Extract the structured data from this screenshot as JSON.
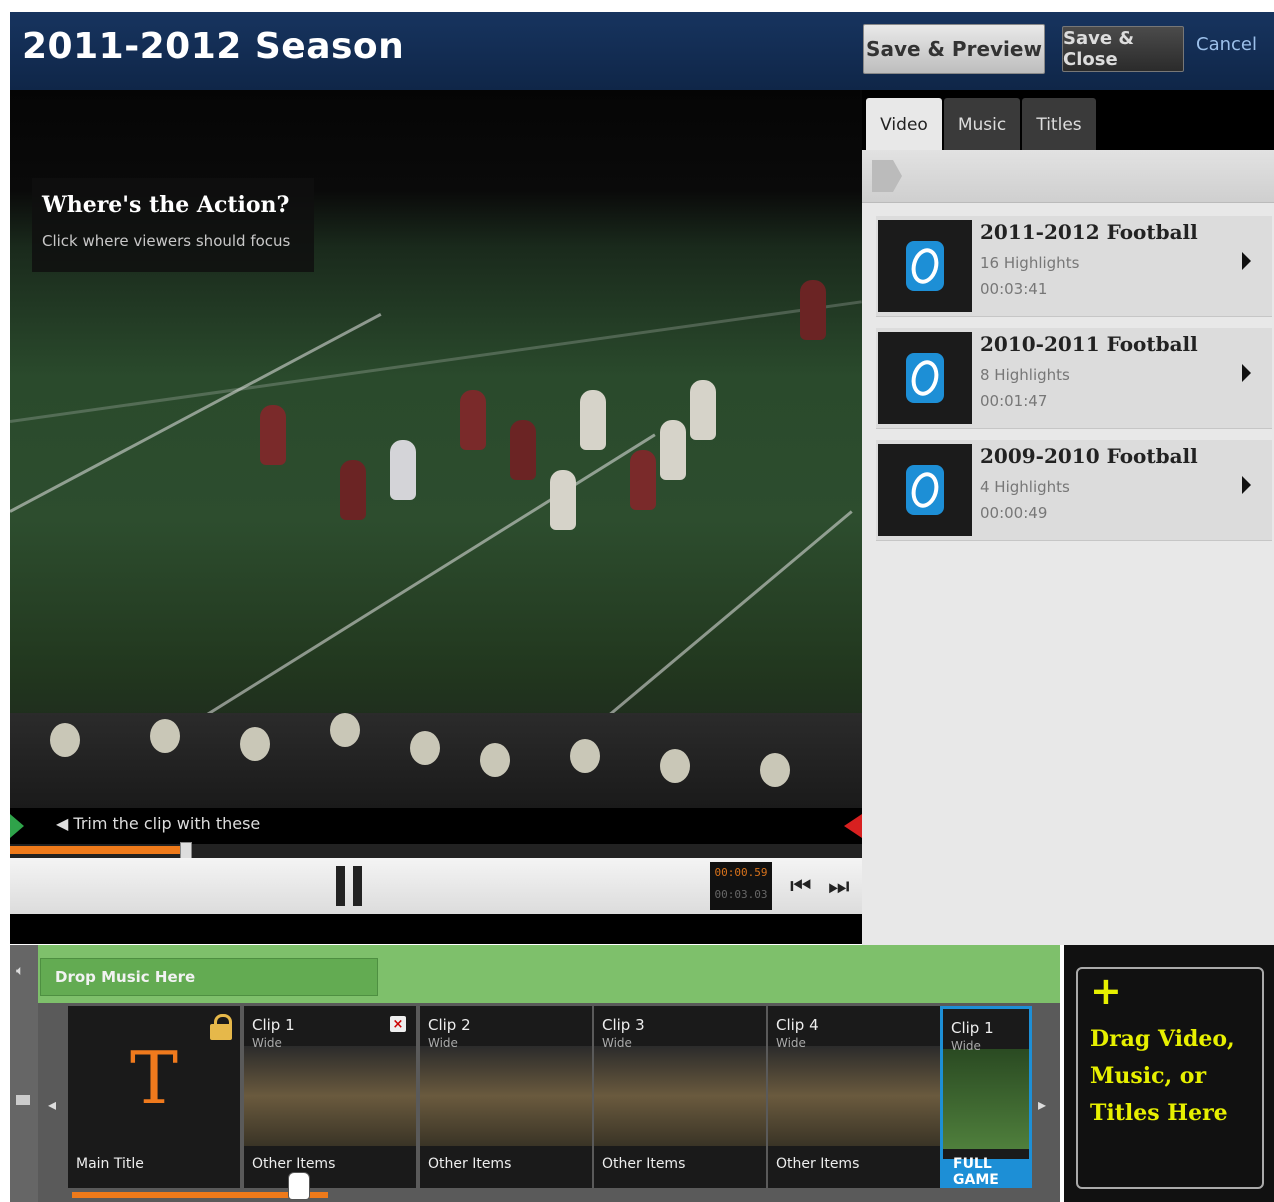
{
  "header": {
    "title": "2011-2012 Season",
    "save_preview": "Save & Preview",
    "save_close": "Save & Close",
    "cancel": "Cancel"
  },
  "video": {
    "callout_title": "Where's the Action?",
    "callout_subtitle": "Click where viewers should focus",
    "trim_hint": "Trim the clip with these",
    "timecode_current": "00:00.59",
    "timecode_total": "00:03.03",
    "progress": 0.2
  },
  "panel": {
    "tabs": [
      "Video",
      "Music",
      "Titles"
    ],
    "active_tab": "Video",
    "items": [
      {
        "title": "2011-2012 Football",
        "count": "16 Highlights",
        "duration": "00:03:41"
      },
      {
        "title": "2010-2011 Football",
        "count": "8 Highlights",
        "duration": "00:01:47"
      },
      {
        "title": "2009-2010 Football",
        "count": "4 Highlights",
        "duration": "00:00:49"
      }
    ]
  },
  "timeline": {
    "drop_music": "Drop Music Here",
    "clips": [
      {
        "name": "",
        "sub": "",
        "caption": "Main Title",
        "letter": "T"
      },
      {
        "name": "Clip 1",
        "sub": "Wide",
        "caption": "Other Items"
      },
      {
        "name": "Clip 2",
        "sub": "Wide",
        "caption": "Other Items"
      },
      {
        "name": "Clip 3",
        "sub": "Wide",
        "caption": "Other Items"
      },
      {
        "name": "Clip 4",
        "sub": "Wide",
        "caption": "Other Items"
      },
      {
        "name": "Clip 1",
        "sub": "Wide",
        "caption": "FULL GAME"
      }
    ],
    "drag_hint": "Drag Video, Music, or Titles Here",
    "drag_plus": "+"
  },
  "colors": {
    "accent": "#ef7a1a",
    "selection": "#1d8fd6",
    "music_track": "#7ec06b",
    "drag_text": "#e7f000"
  }
}
